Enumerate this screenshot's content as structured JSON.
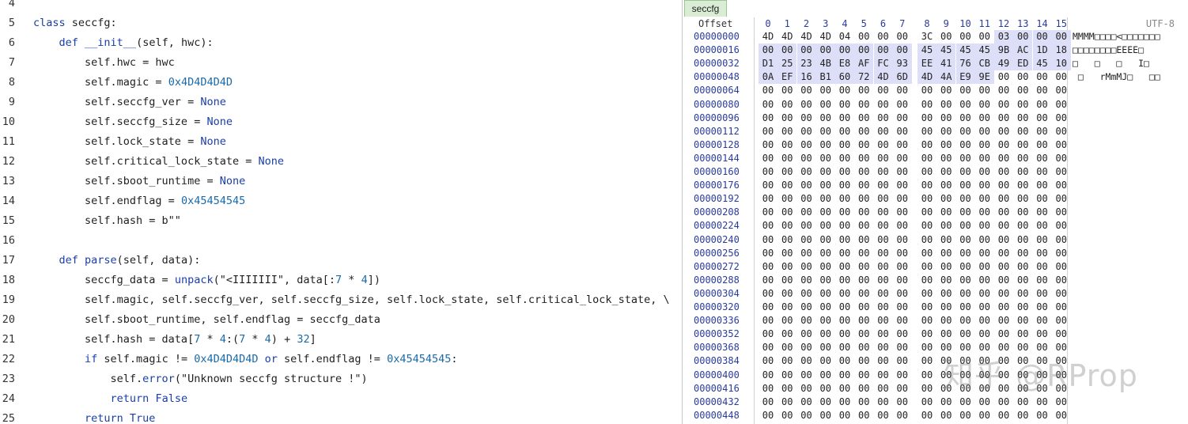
{
  "editor": {
    "lines": [
      {
        "n": "4",
        "tokens": []
      },
      {
        "n": "5",
        "tokens": [
          [
            "kw",
            "class "
          ],
          [
            "",
            "seccfg:"
          ]
        ]
      },
      {
        "n": "6",
        "tokens": [
          [
            "",
            "    "
          ],
          [
            "kw",
            "def "
          ],
          [
            "fn",
            "__init__"
          ],
          [
            "",
            "(self, hwc):"
          ]
        ]
      },
      {
        "n": "7",
        "tokens": [
          [
            "",
            "        self.hwc = hwc"
          ]
        ]
      },
      {
        "n": "8",
        "tokens": [
          [
            "",
            "        self.magic = "
          ],
          [
            "num",
            "0x4D4D4D4D"
          ]
        ]
      },
      {
        "n": "9",
        "tokens": [
          [
            "",
            "        self.seccfg_ver = "
          ],
          [
            "kw",
            "None"
          ]
        ]
      },
      {
        "n": "10",
        "tokens": [
          [
            "",
            "        self.seccfg_size = "
          ],
          [
            "kw",
            "None"
          ]
        ]
      },
      {
        "n": "11",
        "tokens": [
          [
            "",
            "        self.lock_state = "
          ],
          [
            "kw",
            "None"
          ]
        ]
      },
      {
        "n": "12",
        "tokens": [
          [
            "",
            "        self.critical_lock_state = "
          ],
          [
            "kw",
            "None"
          ]
        ]
      },
      {
        "n": "13",
        "tokens": [
          [
            "",
            "        self.sboot_runtime = "
          ],
          [
            "kw",
            "None"
          ]
        ]
      },
      {
        "n": "14",
        "tokens": [
          [
            "",
            "        self.endflag = "
          ],
          [
            "num",
            "0x45454545"
          ]
        ]
      },
      {
        "n": "15",
        "tokens": [
          [
            "",
            "        self.hash = b\"\""
          ]
        ]
      },
      {
        "n": "16",
        "tokens": []
      },
      {
        "n": "17",
        "tokens": [
          [
            "",
            "    "
          ],
          [
            "kw",
            "def "
          ],
          [
            "fn",
            "parse"
          ],
          [
            "",
            "(self, data):"
          ]
        ]
      },
      {
        "n": "18",
        "tokens": [
          [
            "",
            "        seccfg_data = "
          ],
          [
            "fn",
            "unpack"
          ],
          [
            "",
            "(\"<IIIIIII\", data[:"
          ],
          [
            "num",
            "7"
          ],
          [
            "",
            " * "
          ],
          [
            "num",
            "4"
          ],
          [
            "",
            "])"
          ]
        ]
      },
      {
        "n": "19",
        "tokens": [
          [
            "",
            "        self.magic, self.seccfg_ver, self.seccfg_size, self.lock_state, self.critical_lock_state, \\"
          ]
        ]
      },
      {
        "n": "20",
        "tokens": [
          [
            "",
            "        self.sboot_runtime, self.endflag = seccfg_data"
          ]
        ]
      },
      {
        "n": "21",
        "tokens": [
          [
            "",
            "        self.hash = data["
          ],
          [
            "num",
            "7"
          ],
          [
            "",
            " * "
          ],
          [
            "num",
            "4"
          ],
          [
            "",
            ":("
          ],
          [
            "num",
            "7"
          ],
          [
            "",
            " * "
          ],
          [
            "num",
            "4"
          ],
          [
            "",
            ") + "
          ],
          [
            "num",
            "32"
          ],
          [
            "",
            "]"
          ]
        ]
      },
      {
        "n": "22",
        "tokens": [
          [
            "",
            "        "
          ],
          [
            "kw",
            "if "
          ],
          [
            "",
            "self.magic != "
          ],
          [
            "num",
            "0x4D4D4D4D"
          ],
          [
            "kw",
            " or "
          ],
          [
            "",
            "self.endflag != "
          ],
          [
            "num",
            "0x45454545"
          ],
          [
            "",
            ":"
          ]
        ]
      },
      {
        "n": "23",
        "tokens": [
          [
            "",
            "            self."
          ],
          [
            "fn",
            "error"
          ],
          [
            "",
            "(\"Unknown seccfg structure !\")"
          ]
        ]
      },
      {
        "n": "24",
        "tokens": [
          [
            "",
            "            "
          ],
          [
            "kw",
            "return False"
          ]
        ]
      },
      {
        "n": "25",
        "tokens": [
          [
            "",
            "        "
          ],
          [
            "kw",
            "return True"
          ]
        ]
      }
    ]
  },
  "hexview": {
    "tab_label": "seccfg",
    "offset_header": "Offset",
    "encoding": "UTF-8",
    "columns": [
      "0",
      "1",
      "2",
      "3",
      "4",
      "5",
      "6",
      "7",
      "8",
      "9",
      "10",
      "11",
      "12",
      "13",
      "14",
      "15"
    ],
    "rows": [
      {
        "offset": "00000000",
        "bytes": [
          "4D",
          "4D",
          "4D",
          "4D",
          "04",
          "00",
          "00",
          "00",
          "3C",
          "00",
          "00",
          "00",
          "03",
          "00",
          "00",
          "00"
        ],
        "ascii": "MMMM□□□□<□□□□□□□"
      },
      {
        "offset": "00000016",
        "bytes": [
          "00",
          "00",
          "00",
          "00",
          "00",
          "00",
          "00",
          "00",
          "45",
          "45",
          "45",
          "45",
          "9B",
          "AC",
          "1D",
          "18"
        ],
        "ascii": "□□□□□□□□EEEE□"
      },
      {
        "offset": "00000032",
        "bytes": [
          "D1",
          "25",
          "23",
          "4B",
          "E8",
          "AF",
          "FC",
          "93",
          "EE",
          "41",
          "76",
          "CB",
          "49",
          "ED",
          "45",
          "10"
        ],
        "ascii": "□   □   □   I□"
      },
      {
        "offset": "00000048",
        "bytes": [
          "0A",
          "EF",
          "16",
          "B1",
          "60",
          "72",
          "4D",
          "6D",
          "4D",
          "4A",
          "E9",
          "9E",
          "00",
          "00",
          "00",
          "00"
        ],
        "ascii": " □   rMmMJ□   □□"
      },
      {
        "offset": "00000064",
        "bytes": [],
        "ascii": ""
      },
      {
        "offset": "00000080",
        "bytes": [],
        "ascii": ""
      },
      {
        "offset": "00000096",
        "bytes": [],
        "ascii": ""
      },
      {
        "offset": "00000112",
        "bytes": [],
        "ascii": ""
      },
      {
        "offset": "00000128",
        "bytes": [],
        "ascii": ""
      },
      {
        "offset": "00000144",
        "bytes": [],
        "ascii": ""
      },
      {
        "offset": "00000160",
        "bytes": [],
        "ascii": ""
      },
      {
        "offset": "00000176",
        "bytes": [],
        "ascii": ""
      },
      {
        "offset": "00000192",
        "bytes": [],
        "ascii": ""
      },
      {
        "offset": "00000208",
        "bytes": [],
        "ascii": ""
      },
      {
        "offset": "00000224",
        "bytes": [],
        "ascii": ""
      },
      {
        "offset": "00000240",
        "bytes": [],
        "ascii": ""
      },
      {
        "offset": "00000256",
        "bytes": [],
        "ascii": ""
      },
      {
        "offset": "00000272",
        "bytes": [],
        "ascii": ""
      },
      {
        "offset": "00000288",
        "bytes": [],
        "ascii": ""
      },
      {
        "offset": "00000304",
        "bytes": [],
        "ascii": ""
      },
      {
        "offset": "00000320",
        "bytes": [],
        "ascii": ""
      },
      {
        "offset": "00000336",
        "bytes": [],
        "ascii": ""
      },
      {
        "offset": "00000352",
        "bytes": [],
        "ascii": ""
      },
      {
        "offset": "00000368",
        "bytes": [],
        "ascii": ""
      },
      {
        "offset": "00000384",
        "bytes": [],
        "ascii": ""
      },
      {
        "offset": "00000400",
        "bytes": [],
        "ascii": ""
      },
      {
        "offset": "00000416",
        "bytes": [],
        "ascii": ""
      },
      {
        "offset": "00000432",
        "bytes": [],
        "ascii": ""
      },
      {
        "offset": "00000448",
        "bytes": [],
        "ascii": ""
      }
    ],
    "selection_color": "#dcdff7",
    "watermark": "知乎 @RProp"
  }
}
